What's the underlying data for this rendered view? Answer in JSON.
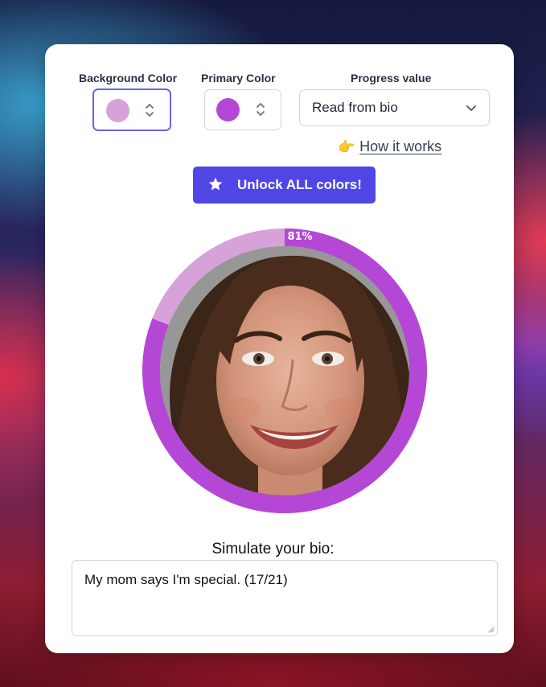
{
  "controls": {
    "background_color": {
      "label": "Background Color",
      "value": "#d7a2d9"
    },
    "primary_color": {
      "label": "Primary Color",
      "value": "#b547d6"
    },
    "progress": {
      "label": "Progress value",
      "selected": "Read from bio"
    }
  },
  "how_it_works": {
    "icon": "pointing-hand-icon",
    "label": "How it works"
  },
  "unlock_button": {
    "icon": "star-icon",
    "label": "Unlock ALL colors!",
    "color": "#4f46e5"
  },
  "avatar": {
    "progress_percent": 81,
    "progress_label": "81%",
    "ring_color": "#b547d6",
    "track_color": "#d7a2d9"
  },
  "bio": {
    "label": "Simulate your bio:",
    "value": "My mom says I'm special. (17/21)"
  }
}
